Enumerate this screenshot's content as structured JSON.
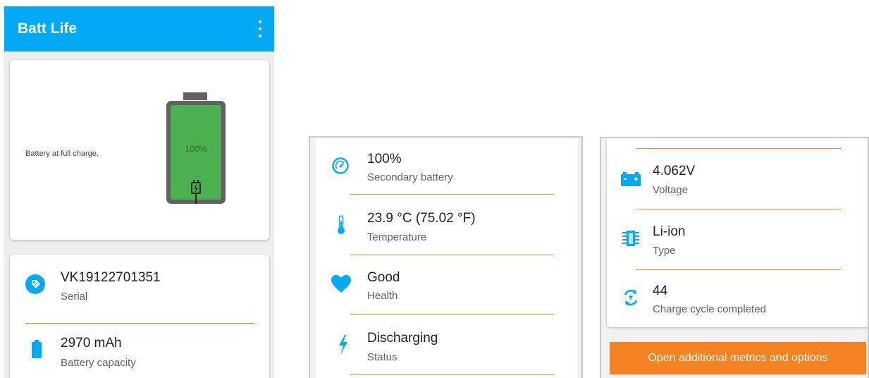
{
  "colors": {
    "appbar": "#03a9f4",
    "accent_icon": "#03a9f4",
    "divider": "#f08c2a",
    "button": "#f58220",
    "battery_fill": "#4caf50",
    "battery_case": "#616161"
  },
  "app": {
    "title": "Batt Life",
    "menu_icon": "overflow-menu-icon"
  },
  "battery_card": {
    "message": "Battery at full charge.",
    "level_text": "100%",
    "level_fraction": 1.0,
    "icon": "charging-plug-icon"
  },
  "info_card": {
    "serial": {
      "value": "VK19122701351",
      "label": "Serial",
      "icon": "tag-icon"
    },
    "capacity": {
      "value": "2970 mAh",
      "label": "Battery capacity",
      "icon": "battery-icon"
    }
  },
  "details_panel": {
    "secondary": {
      "value": "100%",
      "label": "Secondary battery",
      "icon": "gauge-icon"
    },
    "temperature": {
      "value": "23.9 °C (75.02 °F)",
      "label": "Temperature",
      "icon": "thermometer-icon"
    },
    "health": {
      "value": "Good",
      "label": "Health",
      "icon": "heart-icon"
    },
    "status": {
      "value": "Discharging",
      "label": "Status",
      "icon": "lightning-icon"
    }
  },
  "more_panel": {
    "voltage": {
      "value": "4.062V",
      "label": "Voltage",
      "icon": "car-battery-icon"
    },
    "type": {
      "value": "Li-ion",
      "label": "Type",
      "icon": "chip-icon"
    },
    "cycles": {
      "value": "44",
      "label": "Charge cycle completed",
      "icon": "cycle-icon"
    },
    "button_label": "Open additional metrics and options"
  }
}
